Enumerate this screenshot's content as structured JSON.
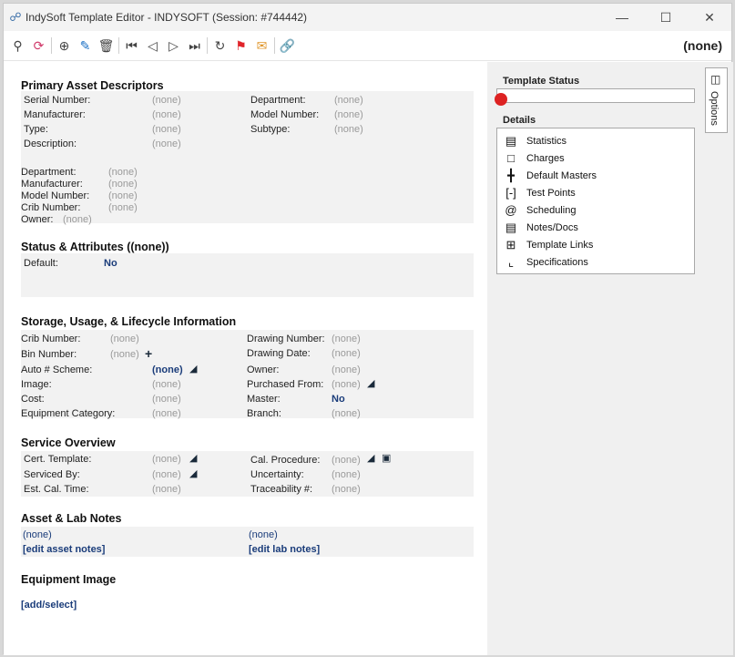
{
  "window": {
    "title": "IndySoft Template Editor - INDYSOFT (Session: #744442)",
    "controls": {
      "minimize": "—",
      "maximize": "☐",
      "close": "✕"
    }
  },
  "toolbar": {
    "right_label": "(none)"
  },
  "primary": {
    "title": "Primary Asset Descriptors",
    "serial_label": "Serial Number:",
    "serial_value": "(none)",
    "dept_label": "Department:",
    "dept_value": "(none)",
    "mfr_label": "Manufacturer:",
    "mfr_value": "(none)",
    "model_label": "Model Number:",
    "model_value": "(none)",
    "type_label": "Type:",
    "type_value": "(none)",
    "subtype_label": "Subtype:",
    "subtype_value": "(none)",
    "desc_label": "Description:",
    "desc_value": "(none)",
    "sub": {
      "dept_label": "Department:",
      "dept_value": "(none)",
      "mfr_label": "Manufacturer:",
      "mfr_value": "(none)",
      "model_label": "Model Number:",
      "model_value": "(none)",
      "crib_label": "Crib Number:",
      "crib_value": "(none)",
      "owner_label": "Owner:",
      "owner_value": "(none)"
    }
  },
  "status": {
    "title": "Status & Attributes ((none))",
    "default_label": "Default:",
    "default_value": "No"
  },
  "storage": {
    "title": "Storage, Usage, & Lifecycle Information",
    "crib_label": "Crib Number:",
    "crib_value": "(none)",
    "drawing_num_label": "Drawing Number:",
    "drawing_num_value": "(none)",
    "bin_label": "Bin Number:",
    "bin_value": "(none)",
    "drawing_date_label": "Drawing Date:",
    "drawing_date_value": "(none)",
    "auto_label": "Auto # Scheme:",
    "auto_value": "(none)",
    "owner_label": "Owner:",
    "owner_value": "(none)",
    "image_label": "Image:",
    "image_value": "(none)",
    "purchased_label": "Purchased From:",
    "purchased_value": "(none)",
    "cost_label": "Cost:",
    "cost_value": "(none)",
    "master_label": "Master:",
    "master_value": "No",
    "equip_cat_label": "Equipment Category:",
    "equip_cat_value": "(none)",
    "branch_label": "Branch:",
    "branch_value": "(none)"
  },
  "service": {
    "title": "Service Overview",
    "cert_label": "Cert. Template:",
    "cert_value": "(none)",
    "cal_label": "Cal. Procedure:",
    "cal_value": "(none)",
    "serviced_label": "Serviced By:",
    "serviced_value": "(none)",
    "uncert_label": "Uncertainty:",
    "uncert_value": "(none)",
    "est_label": "Est. Cal. Time:",
    "est_value": "(none)",
    "trace_label": "Traceability #:",
    "trace_value": "(none)"
  },
  "notes": {
    "title": "Asset & Lab Notes",
    "asset_value": "(none)",
    "asset_link": "[edit asset notes]",
    "lab_value": "(none)",
    "lab_link": "[edit lab notes]"
  },
  "image": {
    "title": "Equipment Image",
    "link": "[add/select]"
  },
  "side": {
    "status_title": "Template Status",
    "details_title": "Details",
    "details": [
      {
        "label": "Statistics",
        "icon": "chart-icon"
      },
      {
        "label": "Charges",
        "icon": "bookmark-icon"
      },
      {
        "label": "Default Masters",
        "icon": "master-icon"
      },
      {
        "label": "Test Points",
        "icon": "brackets-icon"
      },
      {
        "label": "Scheduling",
        "icon": "paperclip-icon"
      },
      {
        "label": "Notes/Docs",
        "icon": "book-icon"
      },
      {
        "label": "Template Links",
        "icon": "grid-icon"
      },
      {
        "label": "Specifications",
        "icon": "crop-icon"
      }
    ],
    "options_tab": "Options"
  },
  "colors": {
    "accent": "#1a3c7a",
    "status_red": "#dd2222",
    "panel": "#f0f0f0"
  }
}
